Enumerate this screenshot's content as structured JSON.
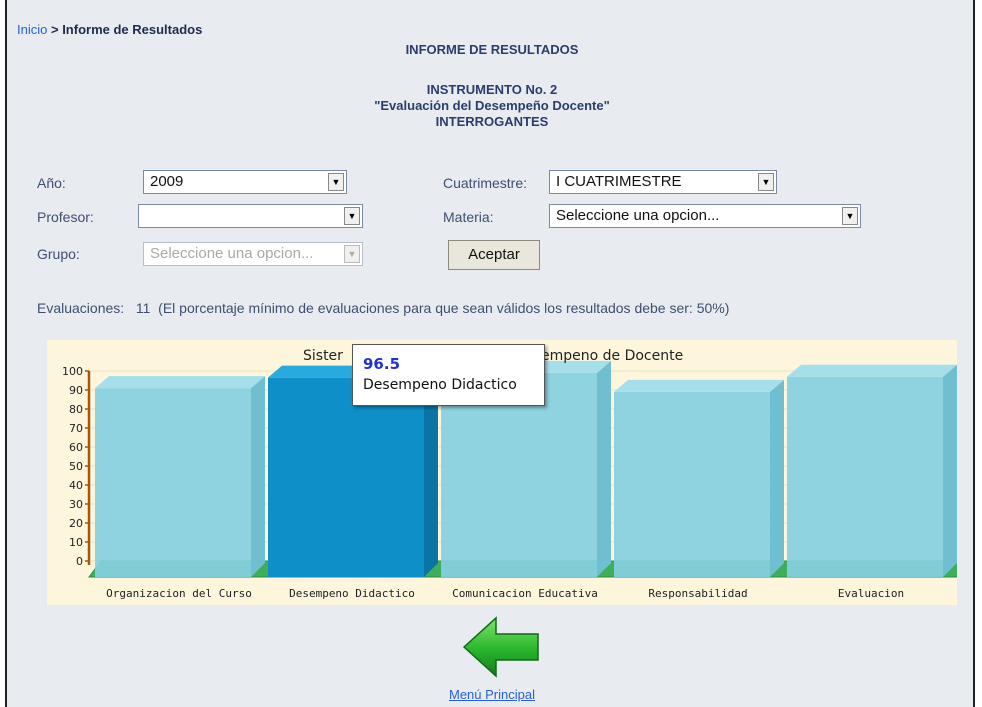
{
  "breadcrumb": {
    "home": "Inicio",
    "separator": " > ",
    "current": "Informe de Resultados"
  },
  "header": {
    "title": "INFORME DE RESULTADOS",
    "instrument": "INSTRUMENTO No. 2",
    "evaluation": "\"Evaluación del Desempeño Docente\"",
    "section": "INTERROGANTES"
  },
  "form": {
    "year_label": "Año:",
    "year_value": "2009",
    "term_label": "Cuatrimestre:",
    "term_value": "I CUATRIMESTRE",
    "teacher_label": "Profesor:",
    "teacher_value": "",
    "subject_label": "Materia:",
    "subject_value": "Seleccione una opcion...",
    "group_label": "Grupo:",
    "group_value": "Seleccione una opcion...",
    "accept_label": "Aceptar"
  },
  "evaluations": {
    "label": "Evaluaciones:",
    "count": "11",
    "note": "(El porcentaje mínimo de evaluaciones para que sean válidos los resultados debe ser: 50%)"
  },
  "chart_data": {
    "type": "bar",
    "title_visible_start": "Sister",
    "title_visible_end": "empeno de Docente",
    "categories": [
      "Organizacion del Curso",
      "Desempeno Didactico",
      "Comunicacion Educativa",
      "Responsabilidad",
      "Evaluacion"
    ],
    "values": [
      91,
      96.5,
      99,
      89,
      97
    ],
    "highlighted_index": 1,
    "ylim": [
      0,
      100
    ],
    "yticks": [
      "0",
      "10",
      "20",
      "30",
      "40",
      "50",
      "60",
      "70",
      "80",
      "90",
      "100"
    ],
    "colors": {
      "bar": "#86cfdf",
      "bar_highlight": "#0e8fc8",
      "floor": "#3fae5b",
      "background": "#fdf6dc"
    }
  },
  "tooltip": {
    "value": "96.5",
    "label": "Desempeno Didactico"
  },
  "footer": {
    "menu_label": "Menú Principal"
  },
  "icons": {
    "back": "green-left-arrow-icon",
    "dropdown": "triangle-down"
  }
}
